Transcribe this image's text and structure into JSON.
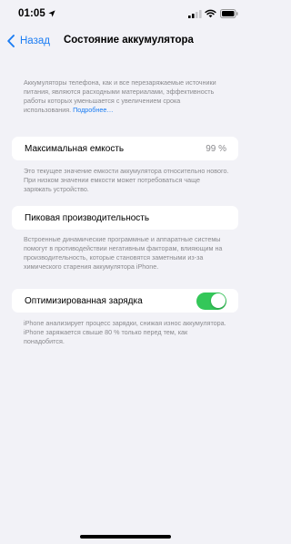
{
  "status_bar": {
    "time": "01:05",
    "icons": [
      "location-arrow-icon",
      "cellular-signal-icon",
      "wifi-icon",
      "battery-icon"
    ]
  },
  "nav": {
    "back_label": "Назад",
    "title": "Состояние аккумулятора"
  },
  "intro": {
    "text": "Аккумуляторы телефона, как и все перезаряжаемые источники питания, являются расходными материалами, эффективность работы которых уменьшается с увеличением срока использования.",
    "link": "Подробнее…"
  },
  "max_capacity": {
    "label": "Максимальная емкость",
    "value": "99 %",
    "note": "Это текущее значение емкости аккумулятора относительно нового. При низком значении емкости может потребоваться чаще заряжать устройство."
  },
  "peak_performance": {
    "label": "Пиковая производительность",
    "note": "Встроенные динамические программные и аппаратные системы помогут в противодействии негативным факторам, влияющим на производительность, которые становятся заметными из-за химического старения аккумулятора iPhone."
  },
  "optimized_charging": {
    "label": "Оптимизированная зарядка",
    "enabled": true,
    "note": "iPhone анализирует процесс зарядки, снижая износ аккумулятора. iPhone заряжается свыше 80 % только перед тем, как понадобится."
  },
  "colors": {
    "accent": "#1a7cf3",
    "toggle_on": "#34c759",
    "background": "#f2f2f7",
    "secondary_text": "#8a8a8e"
  }
}
